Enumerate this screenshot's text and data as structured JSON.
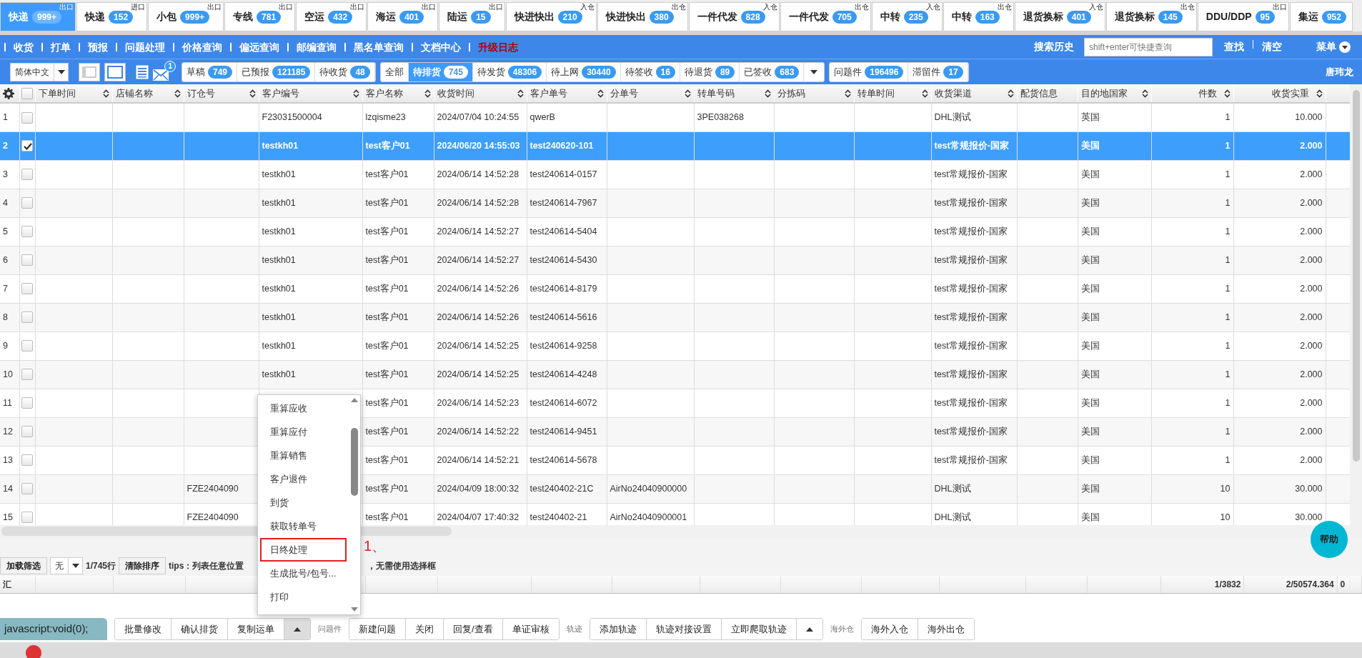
{
  "tabs": [
    {
      "label": "快递",
      "count": "999+",
      "tag": "出口",
      "selected": true
    },
    {
      "label": "快递",
      "count": "152",
      "tag": "进口",
      "selected": false
    },
    {
      "label": "小包",
      "count": "999+",
      "tag": "出口",
      "selected": false
    },
    {
      "label": "专线",
      "count": "781",
      "tag": "出口",
      "selected": false
    },
    {
      "label": "空运",
      "count": "432",
      "tag": "出口",
      "selected": false
    },
    {
      "label": "海运",
      "count": "401",
      "tag": "出口",
      "selected": false
    },
    {
      "label": "陆运",
      "count": "15",
      "tag": "出口",
      "selected": false
    },
    {
      "label": "快进快出",
      "count": "210",
      "tag": "入仓",
      "selected": false
    },
    {
      "label": "快进快出",
      "count": "380",
      "tag": "出仓",
      "selected": false
    },
    {
      "label": "一件代发",
      "count": "828",
      "tag": "入仓",
      "selected": false
    },
    {
      "label": "一件代发",
      "count": "705",
      "tag": "出仓",
      "selected": false
    },
    {
      "label": "中转",
      "count": "235",
      "tag": "入仓",
      "selected": false
    },
    {
      "label": "中转",
      "count": "163",
      "tag": "出仓",
      "selected": false
    },
    {
      "label": "退货换标",
      "count": "401",
      "tag": "入仓",
      "selected": false
    },
    {
      "label": "退货换标",
      "count": "145",
      "tag": "出仓",
      "selected": false
    },
    {
      "label": "DDU/DDP",
      "count": "95",
      "tag": "出口",
      "selected": false
    },
    {
      "label": "集运",
      "count": "952",
      "selected": false
    }
  ],
  "nav": {
    "items": [
      {
        "label": "收货",
        "kind": "normal"
      },
      {
        "label": "打单",
        "kind": "normal"
      },
      {
        "label": "预报",
        "kind": "normal"
      },
      {
        "label": "问题处理",
        "kind": "normal"
      },
      {
        "label": "价格查询",
        "kind": "normal"
      },
      {
        "label": "偏远查询",
        "kind": "normal"
      },
      {
        "label": "邮编查询",
        "kind": "normal"
      },
      {
        "label": "黑名单查询",
        "kind": "normal"
      },
      {
        "label": "文档中心",
        "kind": "normal"
      },
      {
        "label": "升级日志",
        "kind": "highlight"
      }
    ],
    "search_history": "搜索历史",
    "search": {
      "placeholder": "shift+enter可快捷查询"
    },
    "find": "查找",
    "clear": "清空",
    "menu": "菜单"
  },
  "toolbar": {
    "language": "简体中文",
    "layouts": [
      {
        "selected": false
      },
      {
        "selected": true
      }
    ],
    "mail_badge": "1",
    "filter_groups": [
      {
        "has_more": false,
        "items": [
          {
            "label": "草稿",
            "count": "749",
            "selected": false
          },
          {
            "label": "已预报",
            "count": "121185",
            "selected": false
          },
          {
            "label": "待收货",
            "count": "48",
            "selected": false
          }
        ]
      },
      {
        "has_more": true,
        "items": [
          {
            "label": "全部",
            "selected": false
          },
          {
            "label": "待排货",
            "count": "745",
            "selected": true
          },
          {
            "label": "待发货",
            "count": "48306",
            "selected": false
          },
          {
            "label": "待上网",
            "count": "30440",
            "selected": false
          },
          {
            "label": "待签收",
            "count": "16",
            "selected": false
          },
          {
            "label": "待退货",
            "count": "89",
            "selected": false
          },
          {
            "label": "已签收",
            "count": "683",
            "selected": false
          }
        ]
      },
      {
        "has_more": false,
        "items": [
          {
            "label": "问题件",
            "count": "196496",
            "selected": false
          },
          {
            "label": "滞留件",
            "count": "17",
            "selected": false
          }
        ]
      }
    ],
    "user": "唐玮龙"
  },
  "table": {
    "select_all_checked": false,
    "columns": [
      {
        "label": "下单时间",
        "sortable": true,
        "kind": "text"
      },
      {
        "label": "店铺名称",
        "sortable": true,
        "kind": "text"
      },
      {
        "label": "订仓号",
        "sortable": true,
        "kind": "text"
      },
      {
        "label": "客户编号",
        "sortable": true,
        "kind": "text"
      },
      {
        "label": "客户名称",
        "sortable": true,
        "kind": "text"
      },
      {
        "label": "收货时间",
        "sortable": true,
        "kind": "text"
      },
      {
        "label": "客户单号",
        "sortable": true,
        "kind": "text"
      },
      {
        "label": "分单号",
        "sortable": true,
        "kind": "text"
      },
      {
        "label": "转单号码",
        "sortable": true,
        "kind": "text"
      },
      {
        "label": "分拣码",
        "sortable": true,
        "kind": "text"
      },
      {
        "label": "转单时间",
        "sortable": true,
        "kind": "text"
      },
      {
        "label": "收货渠道",
        "sortable": true,
        "kind": "text"
      },
      {
        "label": "配货信息",
        "sortable": false,
        "kind": "text"
      },
      {
        "label": "目的地国家",
        "sortable": true,
        "kind": "text"
      },
      {
        "label": "件数",
        "sortable": true,
        "kind": "number"
      },
      {
        "label": "收货实重",
        "sortable": true,
        "kind": "number"
      }
    ],
    "rows": [
      {
        "no": "1",
        "checked": false,
        "selected": false,
        "cells": [
          null,
          null,
          null,
          "F23031500004",
          "lzqisme23",
          "2024/07/04 10:24:55",
          "qwerB",
          null,
          "3PE038268",
          null,
          null,
          "DHL测试",
          null,
          "英国",
          "1",
          "10.000"
        ]
      },
      {
        "no": "2",
        "checked": true,
        "selected": true,
        "cells": [
          null,
          null,
          null,
          "testkh01",
          "test客户01",
          "2024/06/20 14:55:03",
          "test240620-101",
          null,
          null,
          null,
          null,
          "test常规报价-国家",
          null,
          "美国",
          "1",
          "2.000"
        ]
      },
      {
        "no": "3",
        "checked": false,
        "selected": false,
        "cells": [
          null,
          null,
          null,
          "testkh01",
          "test客户01",
          "2024/06/14 14:52:28",
          "test240614-0157",
          null,
          null,
          null,
          null,
          "test常规报价-国家",
          null,
          "美国",
          "1",
          "2.000"
        ]
      },
      {
        "no": "4",
        "checked": false,
        "selected": false,
        "cells": [
          null,
          null,
          null,
          "testkh01",
          "test客户01",
          "2024/06/14 14:52:28",
          "test240614-7967",
          null,
          null,
          null,
          null,
          "test常规报价-国家",
          null,
          "美国",
          "1",
          "2.000"
        ]
      },
      {
        "no": "5",
        "checked": false,
        "selected": false,
        "cells": [
          null,
          null,
          null,
          "testkh01",
          "test客户01",
          "2024/06/14 14:52:27",
          "test240614-5404",
          null,
          null,
          null,
          null,
          "test常规报价-国家",
          null,
          "美国",
          "1",
          "2.000"
        ]
      },
      {
        "no": "6",
        "checked": false,
        "selected": false,
        "cells": [
          null,
          null,
          null,
          "testkh01",
          "test客户01",
          "2024/06/14 14:52:27",
          "test240614-5430",
          null,
          null,
          null,
          null,
          "test常规报价-国家",
          null,
          "美国",
          "1",
          "2.000"
        ]
      },
      {
        "no": "7",
        "checked": false,
        "selected": false,
        "cells": [
          null,
          null,
          null,
          "testkh01",
          "test客户01",
          "2024/06/14 14:52:26",
          "test240614-8179",
          null,
          null,
          null,
          null,
          "test常规报价-国家",
          null,
          "美国",
          "1",
          "2.000"
        ]
      },
      {
        "no": "8",
        "checked": false,
        "selected": false,
        "cells": [
          null,
          null,
          null,
          "testkh01",
          "test客户01",
          "2024/06/14 14:52:26",
          "test240614-5616",
          null,
          null,
          null,
          null,
          "test常规报价-国家",
          null,
          "美国",
          "1",
          "2.000"
        ]
      },
      {
        "no": "9",
        "checked": false,
        "selected": false,
        "cells": [
          null,
          null,
          null,
          "testkh01",
          "test客户01",
          "2024/06/14 14:52:25",
          "test240614-9258",
          null,
          null,
          null,
          null,
          "test常规报价-国家",
          null,
          "美国",
          "1",
          "2.000"
        ]
      },
      {
        "no": "10",
        "checked": false,
        "selected": false,
        "cells": [
          null,
          null,
          null,
          "testkh01",
          "test客户01",
          "2024/06/14 14:52:25",
          "test240614-4248",
          null,
          null,
          null,
          null,
          "test常规报价-国家",
          null,
          "美国",
          "1",
          "2.000"
        ]
      },
      {
        "no": "11",
        "checked": false,
        "selected": false,
        "cells": [
          null,
          null,
          null,
          null,
          "test客户01",
          "2024/06/14 14:52:23",
          "test240614-6072",
          null,
          null,
          null,
          null,
          "test常规报价-国家",
          null,
          "美国",
          "1",
          "2.000"
        ]
      },
      {
        "no": "12",
        "checked": false,
        "selected": false,
        "cells": [
          null,
          null,
          null,
          null,
          "test客户01",
          "2024/06/14 14:52:22",
          "test240614-9451",
          null,
          null,
          null,
          null,
          "test常规报价-国家",
          null,
          "美国",
          "1",
          "2.000"
        ]
      },
      {
        "no": "13",
        "checked": false,
        "selected": false,
        "cells": [
          null,
          null,
          null,
          null,
          "test客户01",
          "2024/06/14 14:52:21",
          "test240614-5678",
          null,
          null,
          null,
          null,
          "test常规报价-国家",
          null,
          "美国",
          "1",
          "2.000"
        ]
      },
      {
        "no": "14",
        "checked": false,
        "selected": false,
        "cells": [
          null,
          null,
          "FZE2404090",
          null,
          "test客户01",
          "2024/04/09 18:00:32",
          "test240402-21C",
          "AirNo24040900000",
          null,
          null,
          null,
          "DHL测试",
          null,
          "美国",
          "10",
          "30.000"
        ]
      },
      {
        "no": "15",
        "checked": false,
        "selected": false,
        "cells": [
          null,
          null,
          "FZE2404090",
          null,
          "test客户01",
          "2024/04/07 17:40:32",
          "test240402-21",
          "AirNo24040900001",
          null,
          null,
          null,
          "DHL测试",
          null,
          "美国",
          "10",
          "30.000"
        ]
      }
    ],
    "summary": {
      "label": "汇",
      "cells": [
        null,
        null,
        null,
        null,
        null,
        null,
        null,
        null,
        null,
        null,
        null,
        null,
        null,
        null,
        "1/3832",
        "2/50574.364",
        "0"
      ]
    }
  },
  "list_footer": {
    "load_filter": "加载筛选",
    "filter_value": "无",
    "row_count": "1/745行",
    "clear_sort": "清除排序",
    "tips": [
      "tips：列表任意位置",
      "，无需使用选择框"
    ]
  },
  "context_menu": {
    "items": [
      {
        "label": "重算应收",
        "highlighted": false
      },
      {
        "label": "重算应付",
        "highlighted": false
      },
      {
        "label": "重算销售",
        "highlighted": false
      },
      {
        "label": "客户退件",
        "highlighted": false
      },
      {
        "label": "到货",
        "highlighted": false
      },
      {
        "label": "获取转单号",
        "highlighted": false
      },
      {
        "label": "日终处理",
        "highlighted": true
      },
      {
        "label": "生成批号/包号...",
        "highlighted": false
      },
      {
        "label": "打印",
        "highlighted": false
      }
    ],
    "annotation": "1、"
  },
  "actions": {
    "status_tooltip": "javascript:void(0);",
    "groups": [
      {
        "buttons": [
          "批量修改",
          "确认排货",
          "复制运单"
        ],
        "has_more": true,
        "more_pressed": true
      },
      {
        "label": "问题件",
        "buttons": [
          "新建问题",
          "关闭",
          "回复/查看",
          "单证审核"
        ],
        "has_more": false
      },
      {
        "label": "轨迹",
        "buttons": [
          "添加轨迹",
          "轨迹对接设置",
          "立即爬取轨迹"
        ],
        "has_more": true,
        "more_pressed": false
      },
      {
        "label": "海外仓",
        "buttons": [
          "海外入仓",
          "海外出仓"
        ],
        "has_more": false
      }
    ]
  },
  "help": "帮助"
}
